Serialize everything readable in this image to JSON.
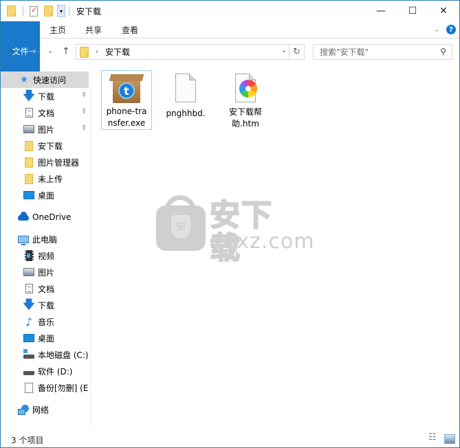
{
  "titlebar": {
    "title": "安下载",
    "minimize_label": "—",
    "maximize_label": "☐",
    "close_label": "✕",
    "qa_dropdown_glyph": "▾"
  },
  "ribbon": {
    "tabs": [
      {
        "label": "文件",
        "active": true
      },
      {
        "label": "主页"
      },
      {
        "label": "共享"
      },
      {
        "label": "查看"
      }
    ],
    "expand_glyph": "⌄",
    "help_glyph": "?"
  },
  "nav": {
    "back_glyph": "←",
    "forward_glyph": "→",
    "recent_glyph": "⌄",
    "up_glyph": "↑",
    "address_sep": "›",
    "address_path": "安下载",
    "address_drop_glyph": "⌄",
    "refresh_glyph": "↻",
    "search_placeholder": "搜索\"安下载\"",
    "search_glyph": "⚲"
  },
  "sidebar": {
    "quick_access": {
      "label": "快速访问",
      "icon": "star-icon"
    },
    "quick_items": [
      {
        "label": "下载",
        "icon": "download-icon",
        "pinned": true
      },
      {
        "label": "文档",
        "icon": "document-icon",
        "pinned": true
      },
      {
        "label": "图片",
        "icon": "pictures-icon",
        "pinned": true
      },
      {
        "label": "安下载",
        "icon": "folder-icon"
      },
      {
        "label": "图片管理器",
        "icon": "folder-icon"
      },
      {
        "label": "未上传",
        "icon": "folder-icon"
      },
      {
        "label": "桌面",
        "icon": "desktop-icon"
      }
    ],
    "onedrive": {
      "label": "OneDrive",
      "icon": "onedrive-icon"
    },
    "this_pc": {
      "label": "此电脑",
      "icon": "computer-icon"
    },
    "pc_items": [
      {
        "label": "视频",
        "icon": "video-icon"
      },
      {
        "label": "图片",
        "icon": "pictures-icon"
      },
      {
        "label": "文档",
        "icon": "document-icon"
      },
      {
        "label": "下载",
        "icon": "download-icon"
      },
      {
        "label": "音乐",
        "icon": "music-icon"
      },
      {
        "label": "桌面",
        "icon": "desktop-icon"
      },
      {
        "label": "本地磁盘 (C:)",
        "icon": "system-drive-icon"
      },
      {
        "label": "软件 (D:)",
        "icon": "drive-icon"
      },
      {
        "label": "备份[勿删] (E:",
        "icon": "file-icon"
      }
    ],
    "network": {
      "label": "网络",
      "icon": "network-icon"
    },
    "pin_glyph": "📌"
  },
  "files": [
    {
      "name": "phone-transfer.exe",
      "line1": "phone-tra",
      "line2": "nsfer.exe",
      "icon": "installer-box-icon",
      "selected": true
    },
    {
      "name": "pnghhbd.",
      "line1": "pnghhbd.",
      "line2": "",
      "icon": "blank-file-icon",
      "selected": false
    },
    {
      "name": "安下载帮助.htm",
      "line1": "安下载帮",
      "line2": "助.htm",
      "icon": "htm-file-icon",
      "selected": false
    }
  ],
  "watermark": {
    "cn": "安下载",
    "en": "anxz.com",
    "shield_char": "安"
  },
  "status": {
    "item_count": "3 个项目"
  }
}
